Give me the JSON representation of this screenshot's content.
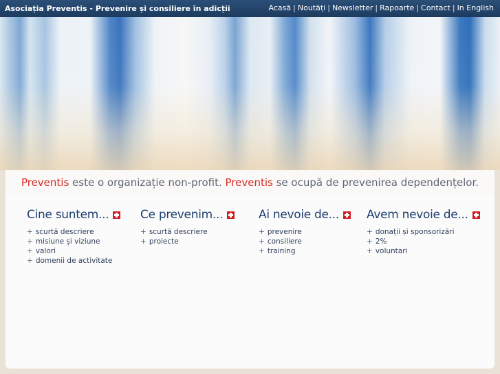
{
  "header": {
    "title": "Asociația Preventis - Prevenire și consiliere în adicții",
    "nav": [
      "Acasă",
      "Noutăți",
      "Newsletter",
      "Rapoarte",
      "Contact",
      "In English"
    ],
    "separator": "|"
  },
  "tagline": {
    "brand1": "Preventis",
    "text1": " este o organizație non-profit. ",
    "brand2": "Preventis",
    "text2": " se ocupă de prevenirea dependențelor."
  },
  "sections": [
    {
      "title": "Cine suntem...",
      "links": [
        "scurtă descriere",
        "misiune și viziune",
        "valori",
        "domenii de activitate"
      ]
    },
    {
      "title": "Ce prevenim...",
      "links": [
        "scurtă descriere",
        "proiecte"
      ]
    },
    {
      "title": "Ai nevoie de...",
      "links": [
        "prevenire",
        "consiliere",
        "training"
      ]
    },
    {
      "title": "Avem nevoie de...",
      "links": [
        "donații și sponsorizări",
        "2%",
        "voluntari"
      ]
    }
  ],
  "link_prefix": "+",
  "colors": {
    "header_bg": "#1d3b5f",
    "brand_red": "#d82a24",
    "title_blue": "#1d3f6e",
    "badge_red": "#d11f26"
  },
  "icons": {
    "expand": "plus-badge-icon"
  }
}
